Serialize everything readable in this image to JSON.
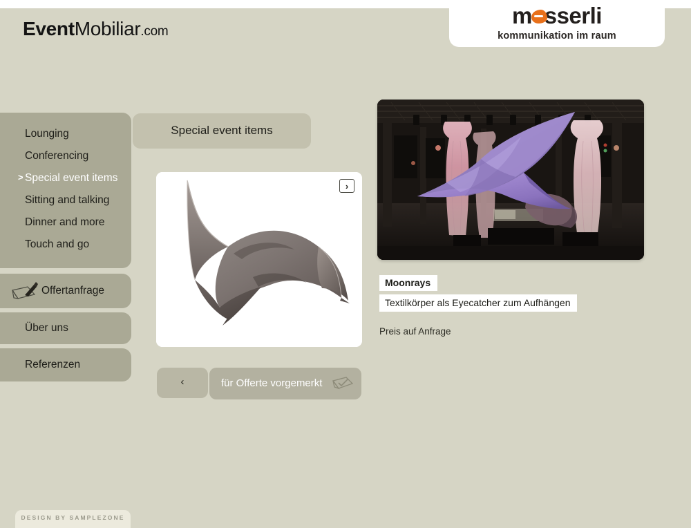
{
  "header": {
    "brand_strong": "Event",
    "brand_light": "Mobiliar",
    "brand_tld": ".com",
    "logo_word": "messerli",
    "logo_tagline": "kommunikation im raum"
  },
  "sidebar": {
    "categories": [
      {
        "label": "Lounging",
        "active": false
      },
      {
        "label": "Conferencing",
        "active": false
      },
      {
        "label": "Special event items",
        "active": true
      },
      {
        "label": "Sitting and talking",
        "active": false
      },
      {
        "label": "Dinner and more",
        "active": false
      },
      {
        "label": "Touch and go",
        "active": false
      }
    ],
    "active_caret": ">",
    "offer_label": "Offertanfrage",
    "offer_icon": "pen-paper-icon",
    "about_label": "Über uns",
    "references_label": "Referenzen"
  },
  "content": {
    "tab_label": "Special event items",
    "next_glyph": "›",
    "prev_glyph": "‹",
    "next_icon": "chevron-right-icon",
    "prev_icon": "chevron-left-icon",
    "offer_mark_label": "für Offerte vorgemerkt",
    "offer_mark_icon": "clipboard-check-icon",
    "thumbnail_alt": "grey stretched fabric sail sculpture on white"
  },
  "detail": {
    "title": "Moonrays",
    "description": "Textilkörper als Eyecatcher zum Aufhängen",
    "price": "Preis auf Anfrage",
    "hero_alt": "purple textile sail suspended in dark industrial hall with pink-lit fabric columns"
  },
  "footer": {
    "credit": "DESIGN BY SAMPLEZONE"
  },
  "colors": {
    "page_bg": "#d6d5c5",
    "sidebar": "#aaa995",
    "tab": "#c3c1ae",
    "button": "#b3b1a0",
    "accent_orange": "#e8701a",
    "footer_tab": "#eceadd"
  }
}
